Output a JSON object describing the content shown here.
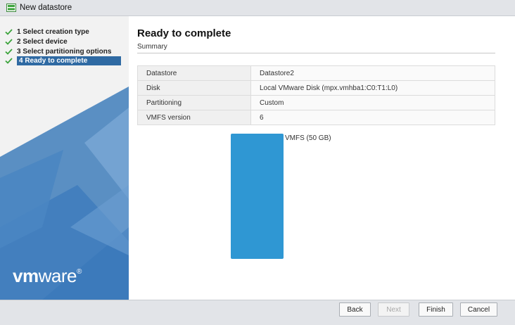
{
  "window": {
    "title": "New datastore"
  },
  "steps": [
    {
      "label": "1 Select creation type",
      "done": true
    },
    {
      "label": "2 Select device",
      "done": true
    },
    {
      "label": "3 Select partitioning options",
      "done": true
    },
    {
      "label": "4 Ready to complete",
      "done": true,
      "active": true
    }
  ],
  "logo": {
    "bold": "vm",
    "rest": "ware",
    "reg": "®"
  },
  "main": {
    "title": "Ready to complete",
    "subtitle": "Summary",
    "summary": [
      {
        "key": "Datastore",
        "value": "Datastore2"
      },
      {
        "key": "Disk",
        "value": "Local VMware Disk (mpx.vmhba1:C0:T1:L0)"
      },
      {
        "key": "Partitioning",
        "value": "Custom"
      },
      {
        "key": "VMFS version",
        "value": "6"
      }
    ],
    "partition": {
      "label": "VMFS  (50 GB)",
      "color": "#2f97d3"
    }
  },
  "footer": {
    "back": "Back",
    "next": "Next",
    "finish": "Finish",
    "cancel": "Cancel"
  },
  "colors": {
    "accent": "#2f6aa3",
    "check": "#3ba33b",
    "titlebar": "#e2e4e8"
  }
}
